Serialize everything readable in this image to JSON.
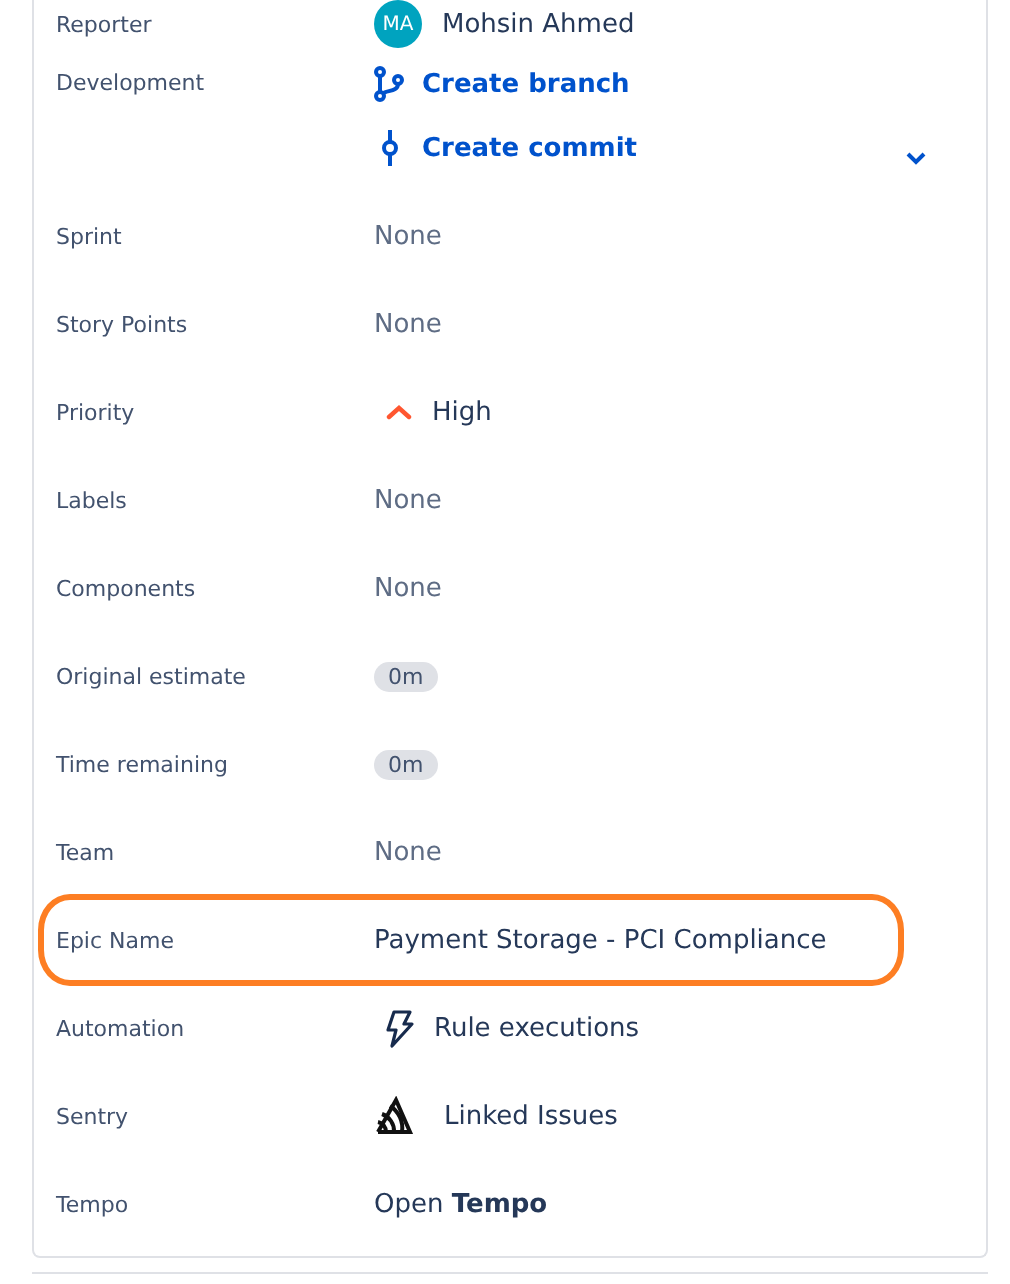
{
  "fields": [
    {
      "label": "Reporter",
      "kind": "person",
      "value": "Mohsin Ahmed",
      "initials": "MA"
    },
    {
      "label": "Development",
      "kind": "links",
      "items": [
        {
          "kind": "branch",
          "text": "Create branch"
        },
        {
          "kind": "commit",
          "text": "Create commit"
        }
      ]
    },
    {
      "label": "Sprint",
      "kind": "empty",
      "value": "None"
    },
    {
      "label": "Story Points",
      "kind": "empty",
      "value": "None"
    },
    {
      "label": "Priority",
      "kind": "priority",
      "value": "High"
    },
    {
      "label": "Labels",
      "kind": "empty",
      "value": "None"
    },
    {
      "label": "Components",
      "kind": "empty",
      "value": "None"
    },
    {
      "label": "Original estimate",
      "kind": "badge",
      "value": "0m"
    },
    {
      "label": "Time remaining",
      "kind": "badge",
      "value": "0m"
    },
    {
      "label": "Team",
      "kind": "empty",
      "value": "None"
    },
    {
      "label": "Epic Name",
      "kind": "text",
      "value": "Payment Storage - PCI Compliance",
      "highlighted": true
    },
    {
      "label": "Automation",
      "kind": "bolt",
      "value": "Rule executions"
    },
    {
      "label": "Sentry",
      "kind": "sentry",
      "value": "Linked Issues"
    },
    {
      "label": "Tempo",
      "kind": "rich",
      "value": "Open **Tempo**"
    }
  ]
}
